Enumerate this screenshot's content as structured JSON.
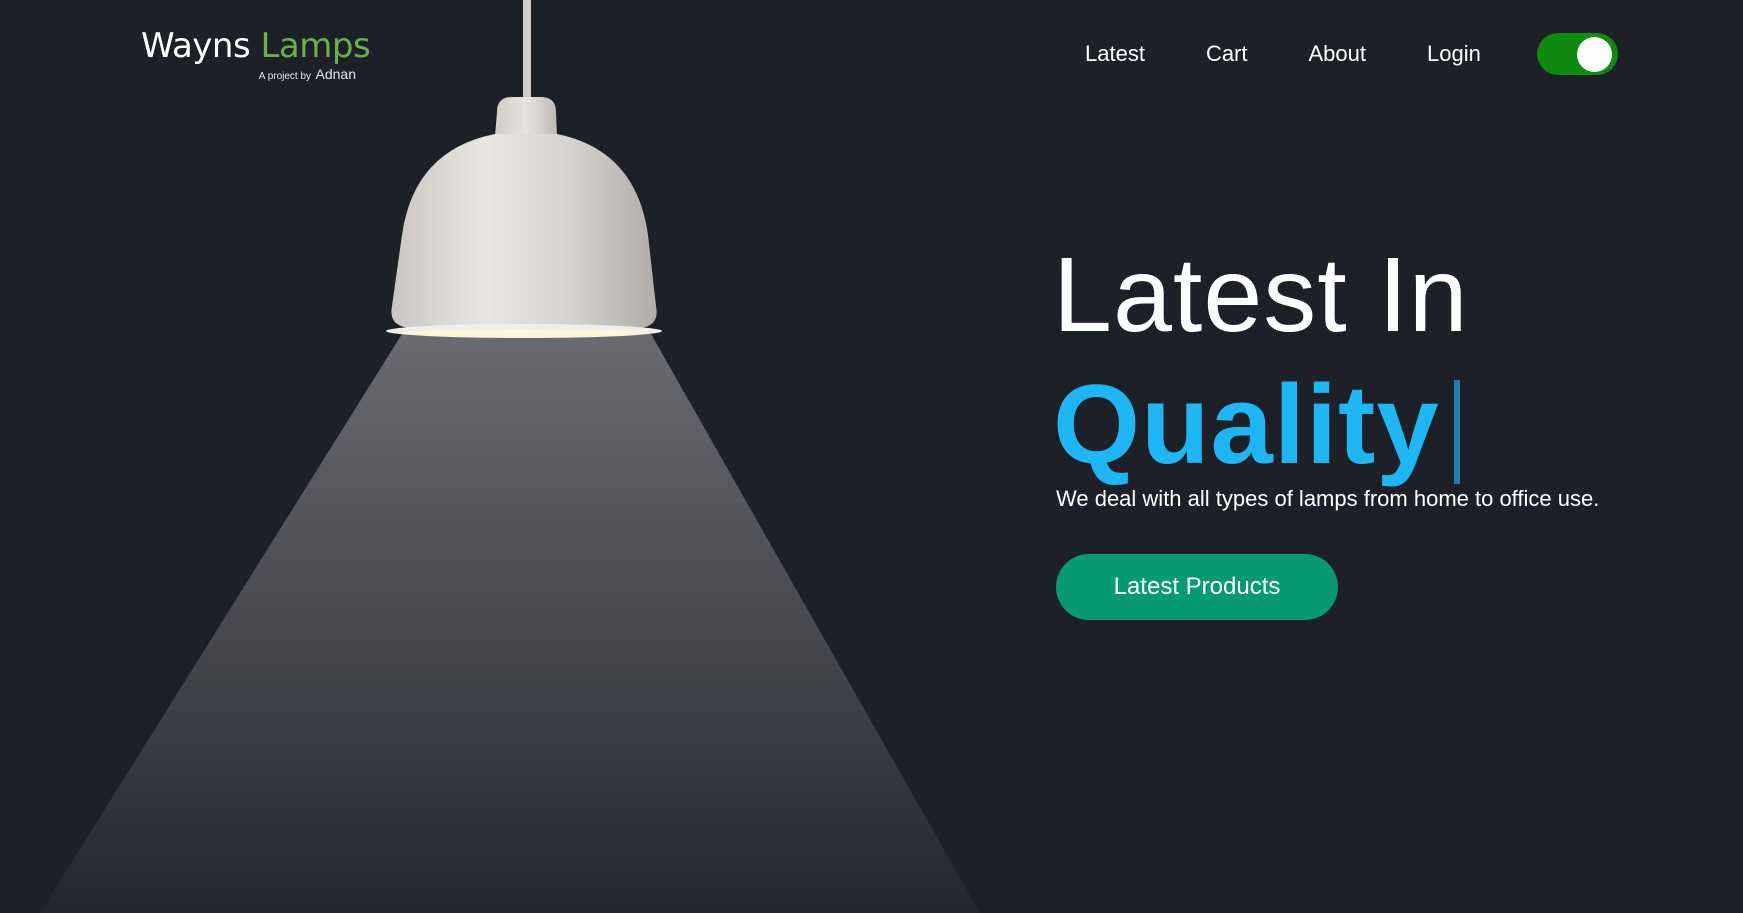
{
  "logo": {
    "word1": "Wayns",
    "word2": "Lamps",
    "byline_prefix": "A project by",
    "byline_name": "Adnan"
  },
  "nav": {
    "items": [
      {
        "label": "Latest"
      },
      {
        "label": "Cart"
      },
      {
        "label": "About"
      },
      {
        "label": "Login"
      }
    ],
    "toggle_state": "on"
  },
  "hero": {
    "line1": "Latest In",
    "line2": "Quality",
    "description": "We deal with all types of lamps from home to office use.",
    "cta_label": "Latest Products"
  },
  "colors": {
    "background": "#1d2027",
    "logo_accent": "#6ab04c",
    "toggle_on": "#0e8a0e",
    "hero_accent": "#1fb6f5",
    "caret": "#1e7fb0",
    "cta": "#059a72"
  },
  "icons": {
    "lamp": "pendant-lamp-illustration",
    "toggle": "theme-toggle-switch"
  }
}
